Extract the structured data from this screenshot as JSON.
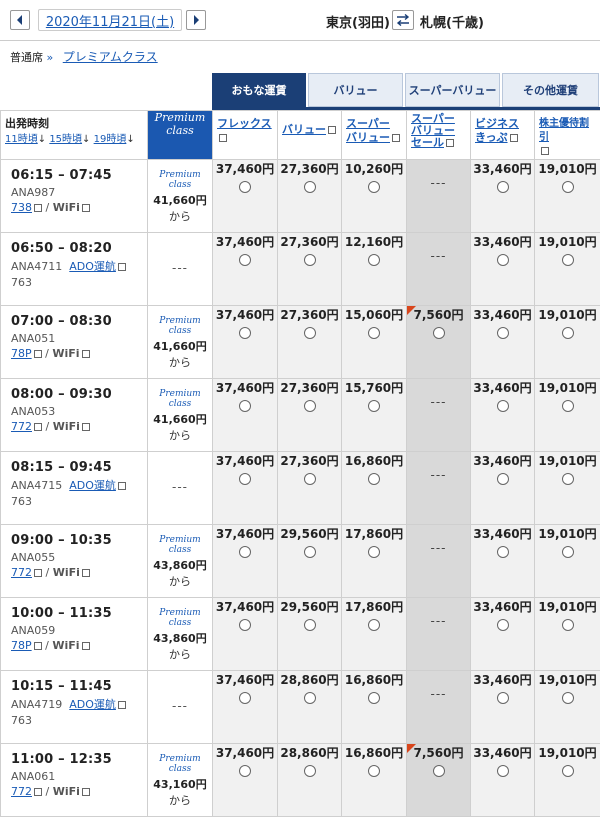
{
  "top": {
    "date": "2020年11月21日(土)",
    "origin": "東京(羽田)",
    "destination": "札幌(千歳)"
  },
  "seat": {
    "label": "普通席",
    "premium_link": "プレミアムクラス"
  },
  "fare_tabs": [
    "おもな運賃",
    "バリュー",
    "スーパーバリュー",
    "その他運賃"
  ],
  "headers": {
    "departure": "出発時刻",
    "sort_11": "11時頃",
    "sort_15": "15時頃",
    "sort_19": "19時頃",
    "premium1": "Premium",
    "premium2": "class",
    "col1": "フレックス",
    "col2": "バリュー",
    "col3a": "スーパー",
    "col3b": "バリュー",
    "col4a": "スーパー",
    "col4b": "バリュー",
    "col4c": "セール",
    "col5a": "ビジネス",
    "col5b": "きっぷ",
    "col6": "株主優待割引"
  },
  "premium_mark": "Premium class",
  "from_text": "から",
  "dash": "---",
  "flights": [
    {
      "time": "06:15 – 07:45",
      "no": "ANA987",
      "ac": "738",
      "wifi": "WiFi",
      "ado": "",
      "prem": "41,660円",
      "f": [
        "37,460円",
        "27,360円",
        "10,260円",
        "---",
        "33,460円",
        "19,010円"
      ]
    },
    {
      "time": "06:50 – 08:20",
      "no": "ANA4711",
      "ac": "763",
      "wifi": "",
      "ado": "ADO運航",
      "prem": "",
      "f": [
        "37,460円",
        "27,360円",
        "12,160円",
        "---",
        "33,460円",
        "19,010円"
      ]
    },
    {
      "time": "07:00 – 08:30",
      "no": "ANA051",
      "ac": "78P",
      "wifi": "WiFi",
      "ado": "",
      "prem": "41,660円",
      "f": [
        "37,460円",
        "27,360円",
        "15,060円",
        "7,560円",
        "33,460円",
        "19,010円"
      ]
    },
    {
      "time": "08:00 – 09:30",
      "no": "ANA053",
      "ac": "772",
      "wifi": "WiFi",
      "ado": "",
      "prem": "41,660円",
      "f": [
        "37,460円",
        "27,360円",
        "15,760円",
        "---",
        "33,460円",
        "19,010円"
      ]
    },
    {
      "time": "08:15 – 09:45",
      "no": "ANA4715",
      "ac": "763",
      "wifi": "",
      "ado": "ADO運航",
      "prem": "",
      "f": [
        "37,460円",
        "27,360円",
        "16,860円",
        "---",
        "33,460円",
        "19,010円"
      ]
    },
    {
      "time": "09:00 – 10:35",
      "no": "ANA055",
      "ac": "772",
      "wifi": "WiFi",
      "ado": "",
      "prem": "43,860円",
      "f": [
        "37,460円",
        "29,560円",
        "17,860円",
        "---",
        "33,460円",
        "19,010円"
      ]
    },
    {
      "time": "10:00 – 11:35",
      "no": "ANA059",
      "ac": "78P",
      "wifi": "WiFi",
      "ado": "",
      "prem": "43,860円",
      "f": [
        "37,460円",
        "29,560円",
        "17,860円",
        "---",
        "33,460円",
        "19,010円"
      ]
    },
    {
      "time": "10:15 – 11:45",
      "no": "ANA4719",
      "ac": "763",
      "wifi": "",
      "ado": "ADO運航",
      "prem": "",
      "f": [
        "37,460円",
        "28,860円",
        "16,860円",
        "---",
        "33,460円",
        "19,010円"
      ]
    },
    {
      "time": "11:00 – 12:35",
      "no": "ANA061",
      "ac": "772",
      "wifi": "WiFi",
      "ado": "",
      "prem": "43,160円",
      "f": [
        "37,460円",
        "28,860円",
        "16,860円",
        "7,560円",
        "33,460円",
        "19,010円"
      ]
    }
  ]
}
